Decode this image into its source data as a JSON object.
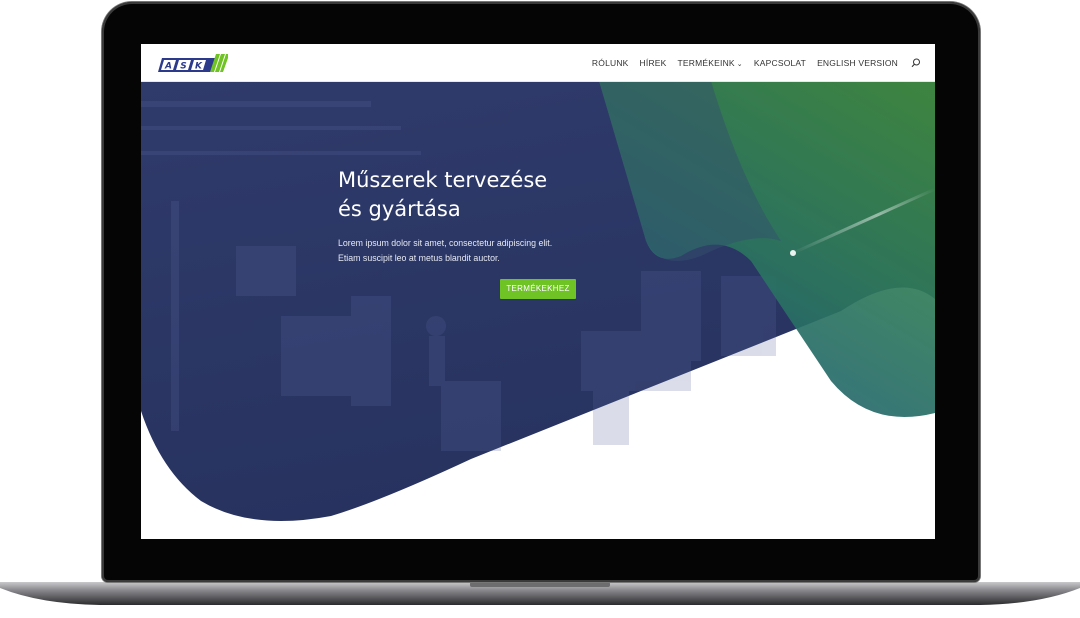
{
  "logo": {
    "text": "ASK"
  },
  "nav": {
    "items": [
      {
        "label": "RÓLUNK"
      },
      {
        "label": "HÍREK"
      },
      {
        "label": "TERMÉKEINK"
      },
      {
        "label": "KAPCSOLAT"
      },
      {
        "label": "ENGLISH VERSION"
      }
    ]
  },
  "hero": {
    "title_line1": "Műszerek tervezése",
    "title_line2": "és gyártása",
    "text_line1": "Lorem ipsum dolor sit amet, consectetur adipiscing elit.",
    "text_line2": "Etiam suscipit leo at metus blandit auctor.",
    "cta_label": "TERMÉKEKHEZ"
  },
  "colors": {
    "hero_navy": "#2a3566",
    "accent_green": "#6fc324",
    "gradient_green": "#3f8a3a",
    "gradient_teal": "#1c6a7a"
  }
}
